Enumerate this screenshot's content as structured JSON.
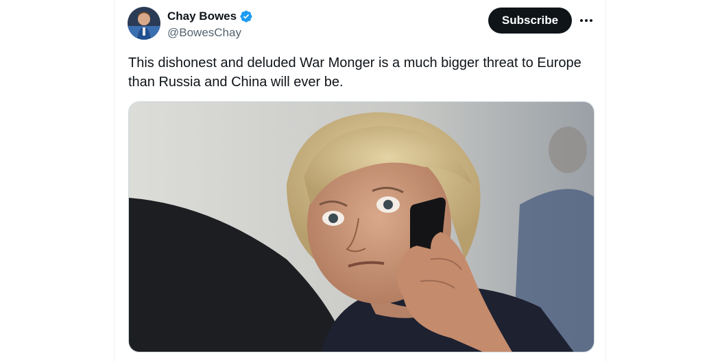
{
  "author": {
    "display_name": "Chay Bowes",
    "handle": "@BowesChay",
    "verified_icon": "verified-badge-icon",
    "verified_color": "#1d9bf0"
  },
  "actions": {
    "subscribe_label": "Subscribe",
    "more_icon": "more-horizontal-icon"
  },
  "tweet": {
    "text": "This dishonest and deluded War Monger is a much bigger threat to Europe than Russia and China will ever be."
  },
  "colors": {
    "text": "#0f1419",
    "secondary": "#536471",
    "button_bg": "#0f1419"
  }
}
